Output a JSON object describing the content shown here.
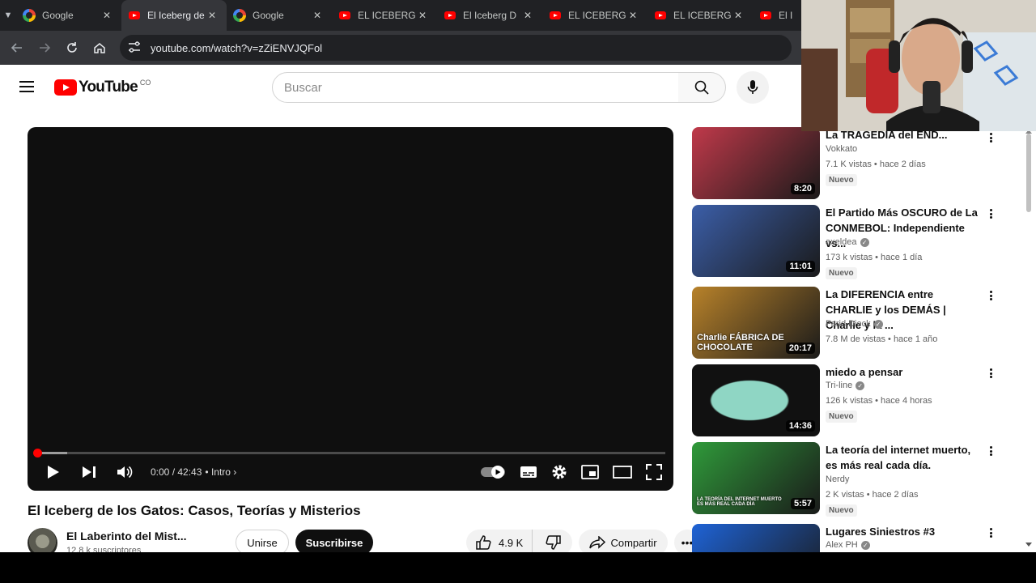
{
  "browser": {
    "tabs": [
      {
        "title": "Google",
        "favicon": "google-favicon",
        "active": false
      },
      {
        "title": "El Iceberg de",
        "favicon": "youtube-favicon",
        "active": true
      },
      {
        "title": "Google",
        "favicon": "google-favicon",
        "active": false
      },
      {
        "title": "EL ICEBERG",
        "favicon": "youtube-favicon",
        "active": false
      },
      {
        "title": "El Iceberg D",
        "favicon": "youtube-favicon",
        "active": false
      },
      {
        "title": "EL ICEBERG",
        "favicon": "youtube-favicon",
        "active": false
      },
      {
        "title": "EL ICEBERG",
        "favicon": "youtube-favicon",
        "active": false
      },
      {
        "title": "El I",
        "favicon": "youtube-favicon",
        "active": false
      }
    ],
    "url": "youtube.com/watch?v=zZiENVJQFol"
  },
  "youtube": {
    "logo_text": "YouTube",
    "country_code": "CO",
    "search_placeholder": "Buscar",
    "player": {
      "time": "0:00 / 42:43",
      "chapter": "Intro",
      "progress_fraction": 0.0
    },
    "video_title": "El Iceberg de los Gatos: Casos, Teorías y Misterios",
    "channel_name": "El Laberinto del Mist...",
    "subscribers": "12.8 k suscriptores",
    "join_label": "Unirse",
    "subscribe_label": "Suscribirse",
    "likes": "4.9 K",
    "share_label": "Compartir"
  },
  "recommendations": [
    {
      "title": "La TRAGEDIA del END...",
      "channel": "Vokkato",
      "verified": false,
      "meta": "7.1 K vistas • hace 2 días",
      "badge": "Nuevo",
      "duration": "8:20",
      "accent": "#c0394a"
    },
    {
      "title": "El Partido Más OSCURO de La CONMEBOL: Independiente vs...",
      "channel": "axeldea",
      "verified": true,
      "meta": "173 k vistas • hace 1 día",
      "badge": "Nuevo",
      "duration": "11:01",
      "accent": "#3b5ea8"
    },
    {
      "title": "La DIFERENCIA entre CHARLIE y los DEMÁS | Charlie y la ...",
      "channel": "Farid Dieck",
      "verified": true,
      "meta": "7.8 M de vistas • hace 1 año",
      "badge": "",
      "duration": "20:17",
      "accent": "#b8822a",
      "thumb_text": "Charlie FÁBRICA DE CHOCOLATE"
    },
    {
      "title": "miedo a pensar",
      "channel": "Tri-line",
      "verified": true,
      "meta": "126 k vistas • hace 4 horas",
      "badge": "Nuevo",
      "duration": "14:36",
      "accent": "#8fd6c4"
    },
    {
      "title": "La teoría del internet muerto, es más real cada día.",
      "channel": "Nerdy",
      "verified": false,
      "meta": "2 K vistas • hace 2 días",
      "badge": "Nuevo",
      "duration": "5:57",
      "accent": "#2f9a3a",
      "thumb_text": "LA TEORÍA DEL INTERNET MUERTO ES MÁS REAL CADA DÍA"
    },
    {
      "title": "Lugares Siniestros #3",
      "channel": "Alex PH",
      "verified": true,
      "meta": "",
      "badge": "",
      "duration": "",
      "accent": "#1e63d6"
    }
  ]
}
